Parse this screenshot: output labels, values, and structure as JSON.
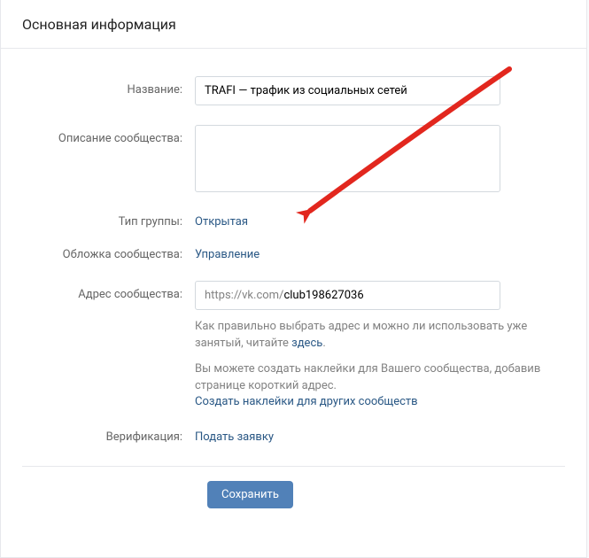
{
  "header": {
    "title": "Основная информация"
  },
  "labels": {
    "name": "Название:",
    "description": "Описание сообщества:",
    "group_type": "Тип группы:",
    "cover": "Обложка сообщества:",
    "address": "Адрес сообщества:",
    "verification": "Верификация:"
  },
  "fields": {
    "name_value": "TRAFI — трафик из социальных сетей",
    "description_value": "",
    "url_prefix": "https://vk.com/",
    "url_slug": "club198627036"
  },
  "links": {
    "group_type": "Открытая",
    "cover_manage": "Управление",
    "here": "здесь",
    "create_stickers": "Создать наклейки для других сообществ",
    "apply_verification": "Подать заявку"
  },
  "hints": {
    "address_rules_pre": "Как правильно выбрать адрес и можно ли использовать уже занятый, читайте ",
    "address_rules_post": ".",
    "stickers_info": "Вы можете создать наклейки для Вашего сообщества, добавив странице короткий адрес."
  },
  "buttons": {
    "save": "Сохранить"
  },
  "colors": {
    "link": "#2a5885",
    "accent_button": "#5181b8",
    "annotation_arrow": "#e2271e"
  }
}
